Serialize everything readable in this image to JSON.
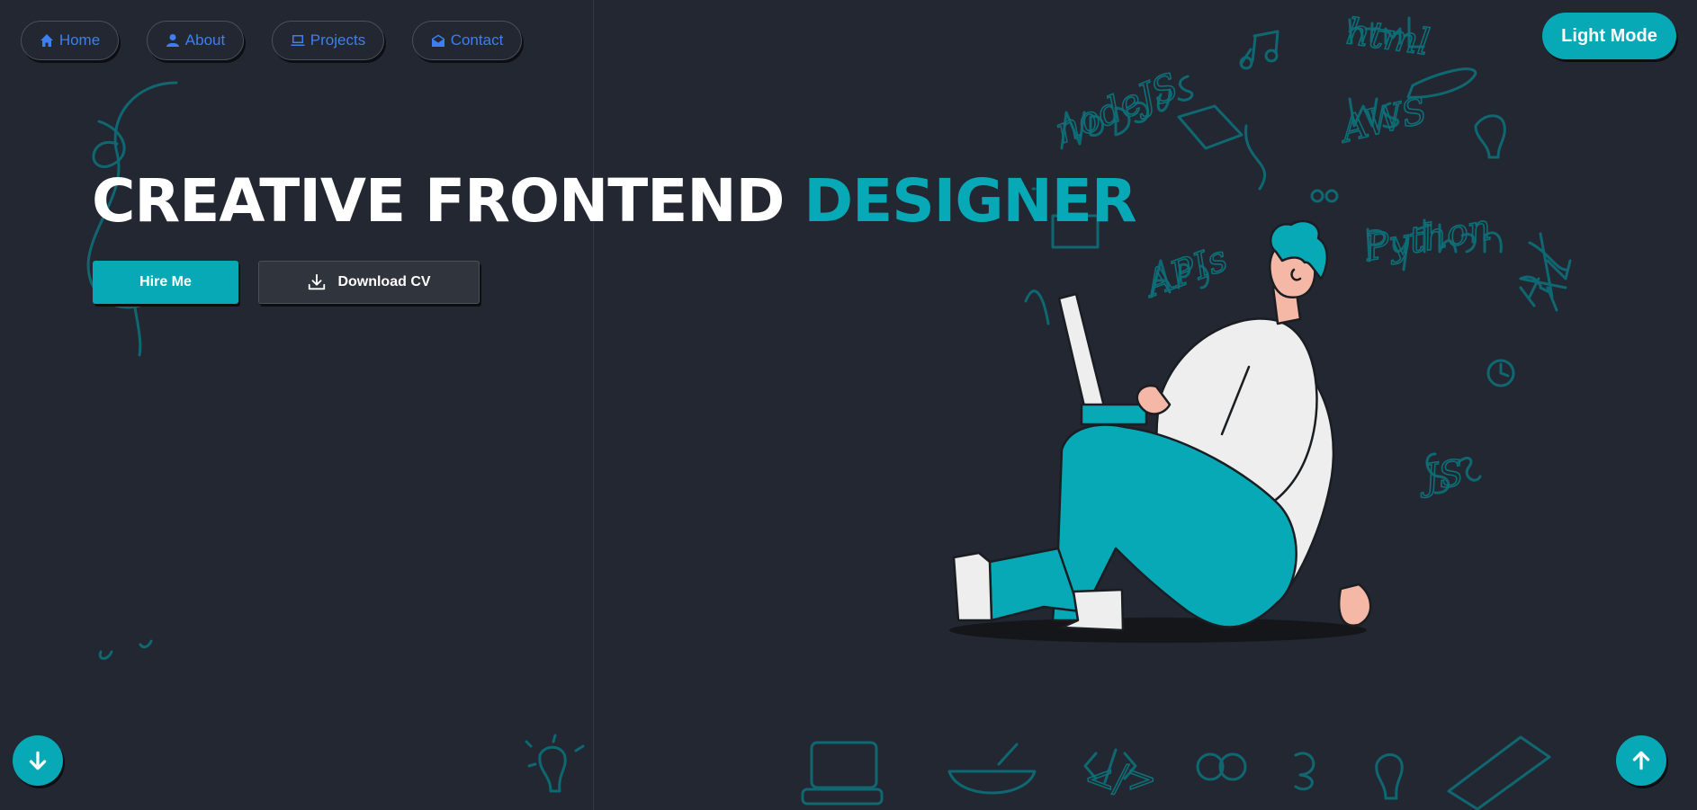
{
  "nav": {
    "items": [
      {
        "label": "Home",
        "icon": "home-icon"
      },
      {
        "label": "About",
        "icon": "user-icon"
      },
      {
        "label": "Projects",
        "icon": "laptop-icon"
      },
      {
        "label": "Contact",
        "icon": "envelope-open-icon"
      }
    ]
  },
  "theme_toggle": {
    "label": "Light Mode"
  },
  "hero": {
    "title_main": "CREATIVE FRONTEND ",
    "title_accent": "DESIGNER",
    "hire_label": "Hire Me",
    "cv_label": "Download CV",
    "cv_icon": "download-icon"
  },
  "scroll": {
    "down_icon": "arrow-down-icon",
    "up_icon": "arrow-up-icon"
  },
  "doodle_words": [
    "html",
    "nodeJS",
    "AWS",
    "APIs",
    "Python",
    "JS",
    "</>"
  ],
  "colors": {
    "background": "#222731",
    "accent": "#08a9b7",
    "nav_text": "#3d7ff0",
    "text": "#ffffff"
  }
}
